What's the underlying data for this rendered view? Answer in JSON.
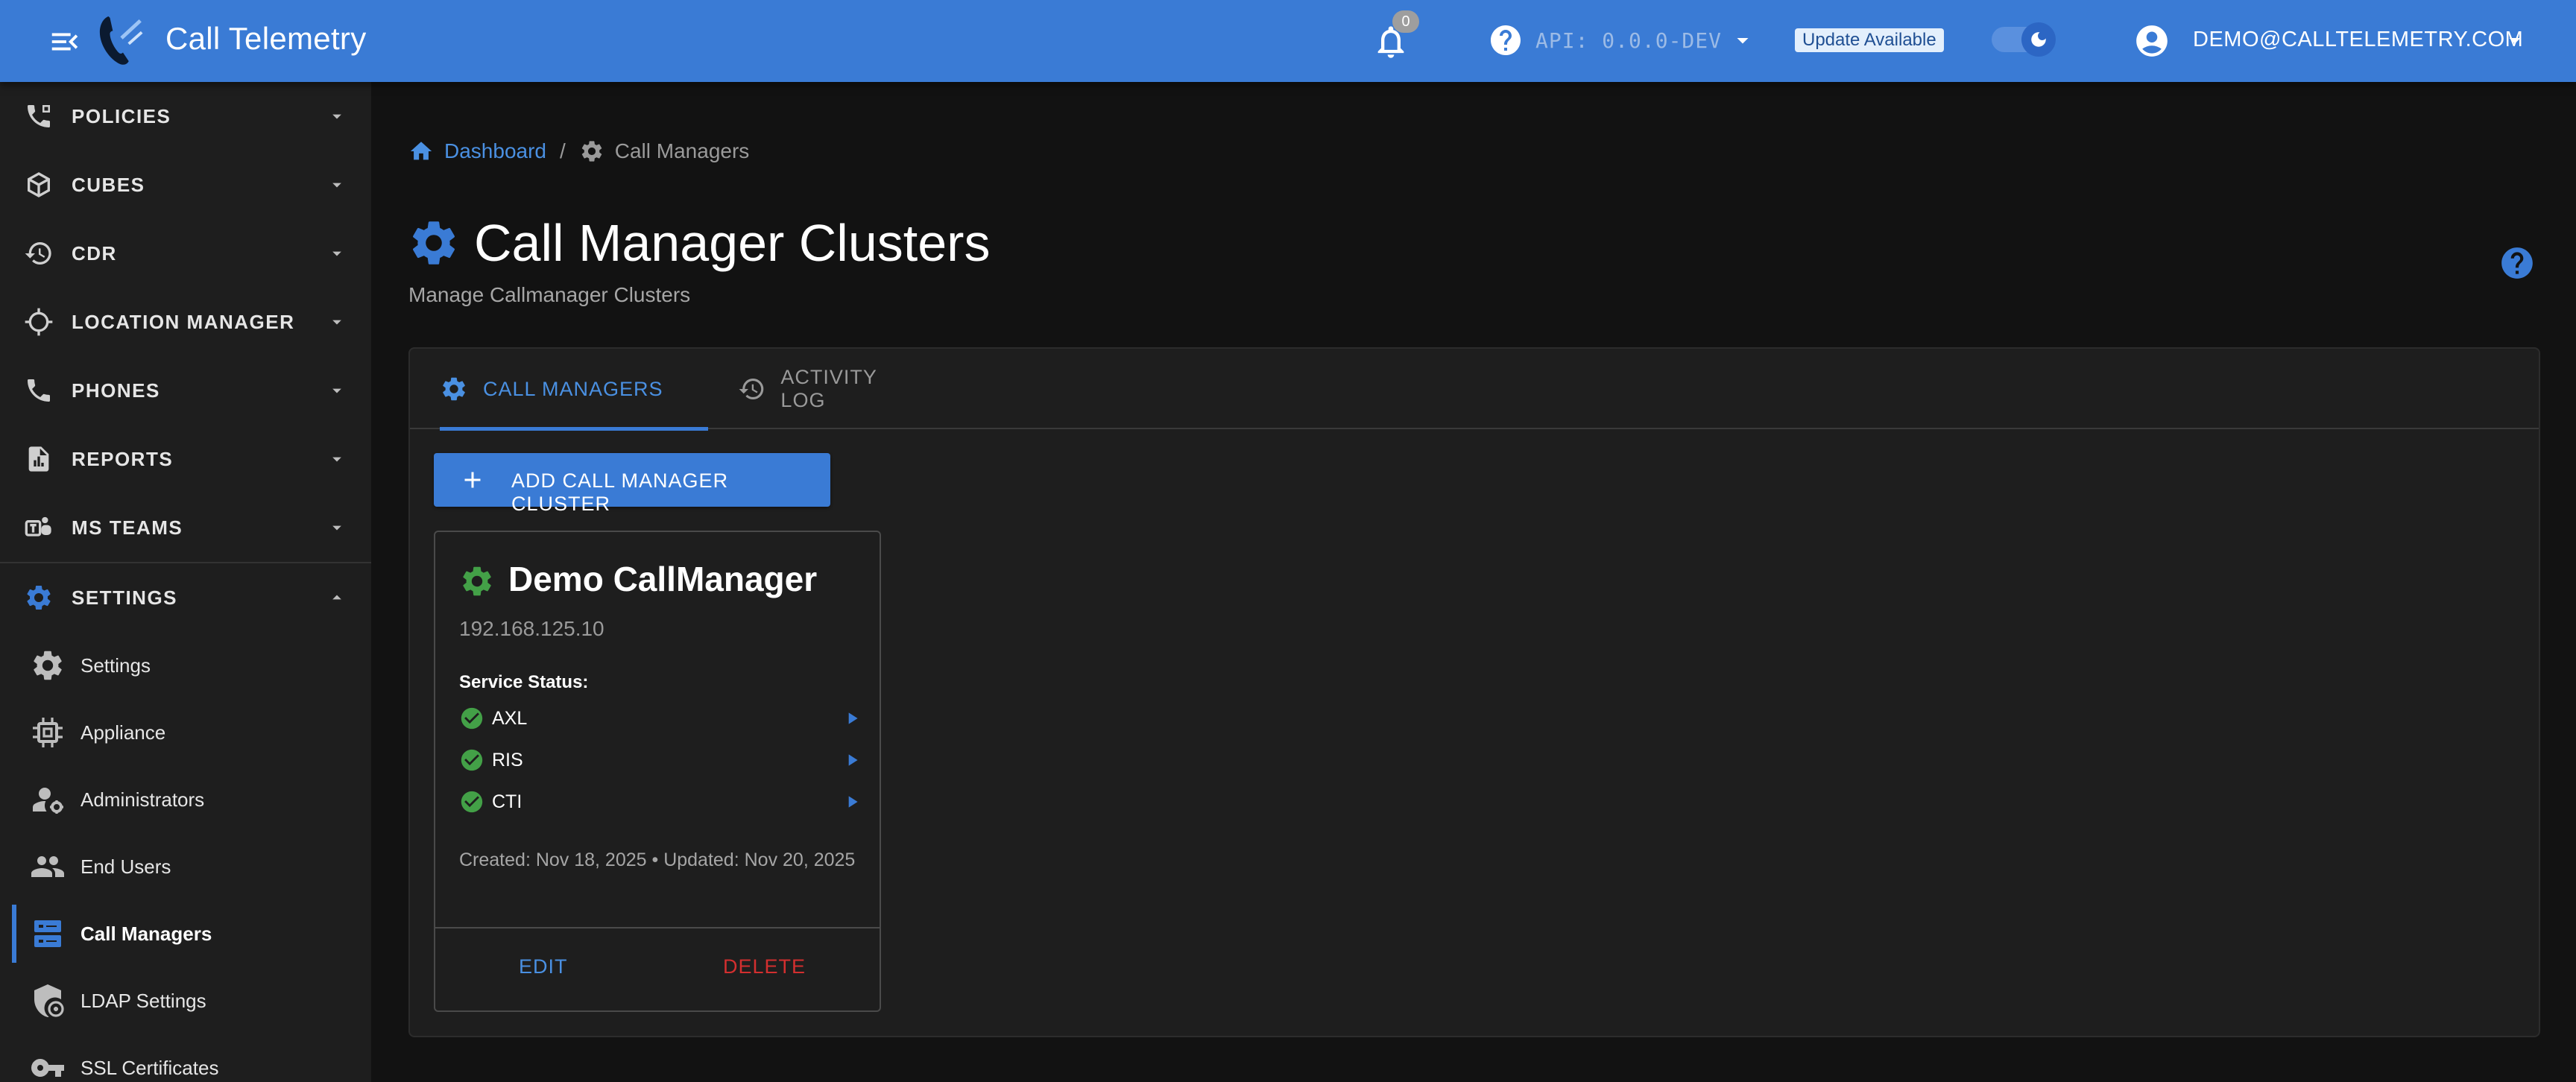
{
  "app": {
    "title": "Call Telemetry"
  },
  "header": {
    "notifications_count": "0",
    "api_version": "API: 0.0.0-DEV",
    "update_badge": "Update Available",
    "user_email": "DEMO@CALLTELEMETRY.COM",
    "theme": "dark",
    "colors": {
      "bar": "#3a7bd5",
      "accent": "#4a90e2",
      "success": "#43a047",
      "danger": "#d32f2f"
    }
  },
  "sidebar": {
    "groups": [
      {
        "label": "POLICIES",
        "icon": "phone-policy-icon",
        "expanded": false
      },
      {
        "label": "CUBES",
        "icon": "cube-icon",
        "expanded": false
      },
      {
        "label": "CDR",
        "icon": "history-icon",
        "expanded": false
      },
      {
        "label": "LOCATION MANAGER",
        "icon": "crosshair-icon",
        "expanded": false
      },
      {
        "label": "PHONES",
        "icon": "phone-icon",
        "expanded": false
      },
      {
        "label": "REPORTS",
        "icon": "report-icon",
        "expanded": false
      },
      {
        "label": "MS TEAMS",
        "icon": "teams-icon",
        "expanded": false
      },
      {
        "label": "SETTINGS",
        "icon": "gear-icon",
        "expanded": true
      }
    ],
    "items": [
      {
        "label": "Settings",
        "icon": "gear-icon"
      },
      {
        "label": "Appliance",
        "icon": "chip-icon"
      },
      {
        "label": "Administrators",
        "icon": "admin-icon"
      },
      {
        "label": "End Users",
        "icon": "people-icon"
      },
      {
        "label": "Call Managers",
        "icon": "server-icon",
        "active": true
      },
      {
        "label": "LDAP Settings",
        "icon": "shield-icon"
      },
      {
        "label": "SSL Certificates",
        "icon": "key-icon"
      }
    ]
  },
  "breadcrumb": {
    "home": "Dashboard",
    "current": "Call Managers"
  },
  "page": {
    "title": "Call Manager Clusters",
    "subtitle": "Manage Callmanager Clusters"
  },
  "tabs": [
    {
      "label": "CALL MANAGERS",
      "active": true
    },
    {
      "label": "ACTIVITY LOG",
      "active": false
    }
  ],
  "actions": {
    "add_label": "ADD CALL MANAGER CLUSTER"
  },
  "cluster_card": {
    "name": "Demo CallManager",
    "ip": "192.168.125.10",
    "service_status_label": "Service Status:",
    "services": [
      {
        "name": "AXL",
        "status": "ok"
      },
      {
        "name": "RIS",
        "status": "ok"
      },
      {
        "name": "CTI",
        "status": "ok"
      }
    ],
    "dates": "Created: Nov 18, 2025 • Updated: Nov 20, 2025",
    "edit_label": "EDIT",
    "delete_label": "DELETE"
  }
}
